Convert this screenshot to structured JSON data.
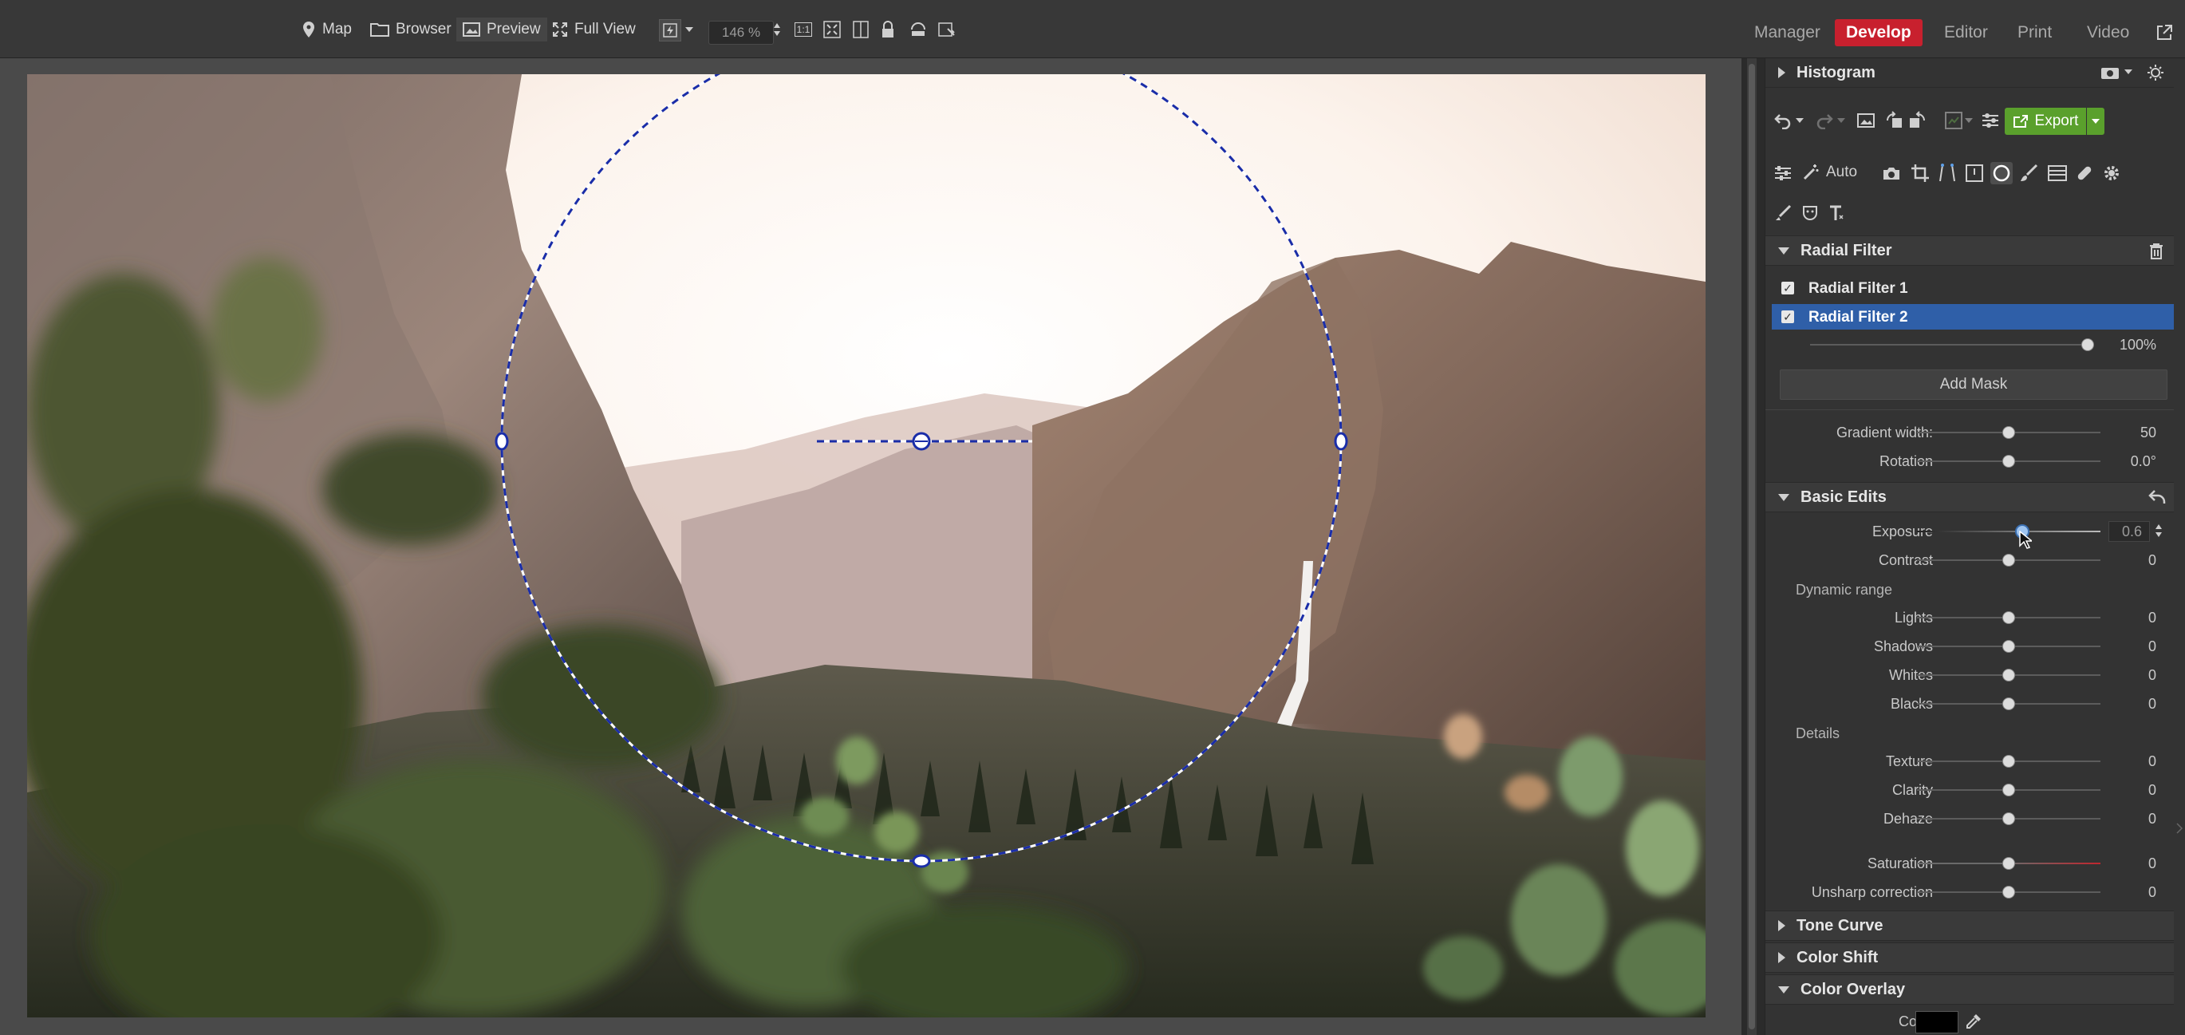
{
  "toolbar": {
    "map_label": "Map",
    "browser_label": "Browser",
    "preview_label": "Preview",
    "fullview_label": "Full View",
    "zoom_value": "146 %",
    "one_to_one": "1:1",
    "modes": [
      "Manager",
      "Develop",
      "Editor",
      "Print",
      "Video"
    ],
    "active_mode": "Develop",
    "accent": "#c8202e"
  },
  "panel": {
    "histogram_title": "Histogram",
    "export_label": "Export",
    "auto_label": "Auto",
    "radial_filter": {
      "title": "Radial Filter",
      "filters": [
        {
          "label": "Radial Filter 1",
          "checked": true,
          "selected": false
        },
        {
          "label": "Radial Filter 2",
          "checked": true,
          "selected": true
        }
      ],
      "opacity_value": "100%",
      "opacity_level": 1.0,
      "add_mask_label": "Add Mask",
      "gradient_width": {
        "label": "Gradient width:",
        "value": "50",
        "level": 0.5
      },
      "rotation": {
        "label": "Rotation",
        "value": "0.0°",
        "level": 0.5
      }
    },
    "basic_edits": {
      "title": "Basic Edits",
      "exposure": {
        "label": "Exposure",
        "value": "0.6",
        "level": 0.57
      },
      "contrast": {
        "label": "Contrast",
        "value": "0",
        "level": 0.5
      },
      "dynamic_range_label": "Dynamic range",
      "lights": {
        "label": "Lights",
        "value": "0",
        "level": 0.5
      },
      "shadows": {
        "label": "Shadows",
        "value": "0",
        "level": 0.5
      },
      "whites": {
        "label": "Whites",
        "value": "0",
        "level": 0.5
      },
      "blacks": {
        "label": "Blacks",
        "value": "0",
        "level": 0.5
      },
      "details_label": "Details",
      "texture": {
        "label": "Texture",
        "value": "0",
        "level": 0.5
      },
      "clarity": {
        "label": "Clarity",
        "value": "0",
        "level": 0.5
      },
      "dehaze": {
        "label": "Dehaze",
        "value": "0",
        "level": 0.5
      },
      "saturation": {
        "label": "Saturation",
        "value": "0",
        "level": 0.5
      },
      "unsharp": {
        "label": "Unsharp correction",
        "value": "0",
        "level": 0.5
      }
    },
    "tone_curve_title": "Tone Curve",
    "color_shift_title": "Color Shift",
    "color_overlay": {
      "title": "Color Overlay",
      "color_label": "Color",
      "swatch": "#000000"
    },
    "selection_color": "#2f5fa8",
    "export_color": "#5aa02c"
  }
}
